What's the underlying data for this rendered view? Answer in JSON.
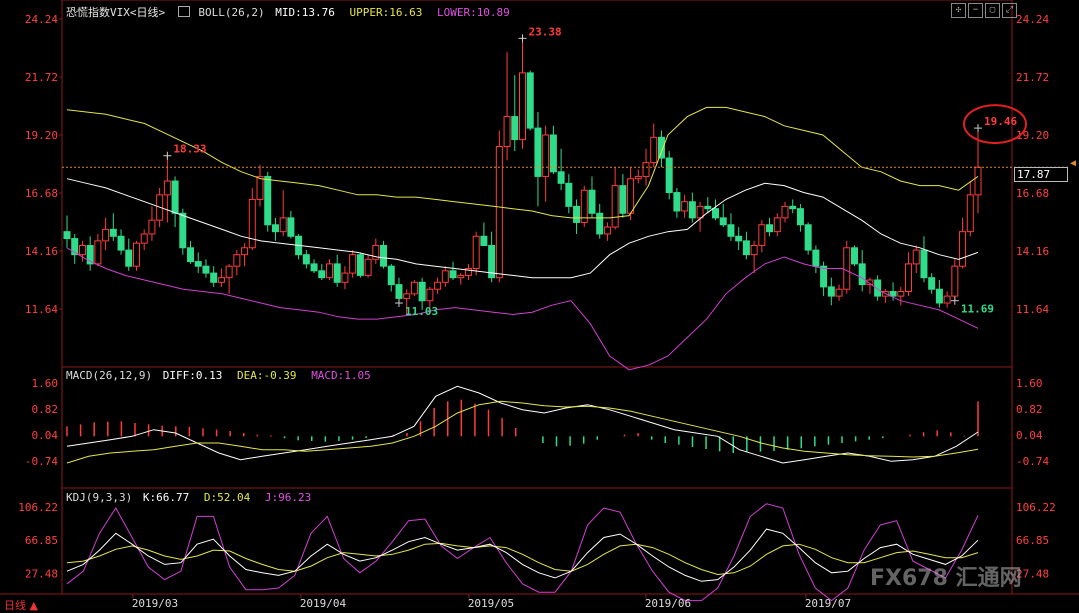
{
  "header": {
    "title": "恐慌指数VIX<日线>",
    "boll_label": "BOLL(26,2)",
    "boll_mid": "MID:13.76",
    "boll_upper": "UPPER:16.63",
    "boll_lower": "LOWER:10.89"
  },
  "macd_header": {
    "name": "MACD(26,12,9)",
    "diff": "DIFF:0.13",
    "dea": "DEA:-0.39",
    "macd": "MACD:1.05"
  },
  "kdj_header": {
    "name": "KDJ(9,3,3)",
    "k": "K:66.77",
    "d": "D:52.04",
    "j": "J:96.23"
  },
  "period_label": "日线",
  "current_price_tag": "17.87",
  "watermark": "FX678 汇通网",
  "colors": {
    "up": "#ff3b3b",
    "down": "#2fdc8a",
    "upper": "#e6e64a",
    "mid": "#ffffff",
    "lower": "#d040d0",
    "axis_text": "#ff4040",
    "kdj_k": "#ffffff",
    "kdj_d": "#e6e64a",
    "kdj_j": "#d040d0"
  },
  "chart_data": [
    {
      "type": "candlestick",
      "title": "恐慌指数VIX<日线>",
      "y_ticks": [
        "24.24",
        "21.72",
        "19.20",
        "16.68",
        "14.16",
        "11.64"
      ],
      "ylim": [
        11.64,
        24.24
      ],
      "x_ticks": [
        "2019/03",
        "2019/04",
        "2019/05",
        "2019/06",
        "2019/07"
      ],
      "annotations": [
        "18.33",
        "23.38",
        "11.03",
        "19.46",
        "11.69"
      ],
      "series_ohlc": [
        [
          15.0,
          15.7,
          14.3,
          14.7
        ],
        [
          14.7,
          14.9,
          13.6,
          14.0
        ],
        [
          14.0,
          14.6,
          13.7,
          14.4
        ],
        [
          14.4,
          14.8,
          13.3,
          13.6
        ],
        [
          13.6,
          14.9,
          13.5,
          14.6
        ],
        [
          14.6,
          15.6,
          14.2,
          15.1
        ],
        [
          15.1,
          15.8,
          14.6,
          14.8
        ],
        [
          14.8,
          15.1,
          14.0,
          14.2
        ],
        [
          14.2,
          14.7,
          13.3,
          13.5
        ],
        [
          13.5,
          14.6,
          13.3,
          14.5
        ],
        [
          14.5,
          15.1,
          14.2,
          14.9
        ],
        [
          14.9,
          16.1,
          14.6,
          15.5
        ],
        [
          15.5,
          16.9,
          15.2,
          16.6
        ],
        [
          16.6,
          18.3,
          15.4,
          17.2
        ],
        [
          17.2,
          17.4,
          15.2,
          15.8
        ],
        [
          15.8,
          16.0,
          14.0,
          14.3
        ],
        [
          14.3,
          14.6,
          13.6,
          13.7
        ],
        [
          13.7,
          14.1,
          13.2,
          13.5
        ],
        [
          13.5,
          13.8,
          13.0,
          13.2
        ],
        [
          13.2,
          13.5,
          12.6,
          12.8
        ],
        [
          12.8,
          13.4,
          12.6,
          13.0
        ],
        [
          13.0,
          13.6,
          12.3,
          13.5
        ],
        [
          13.5,
          14.2,
          13.1,
          14.0
        ],
        [
          14.0,
          14.5,
          13.5,
          14.3
        ],
        [
          14.3,
          16.9,
          14.2,
          16.4
        ],
        [
          16.4,
          17.9,
          16.1,
          17.4
        ],
        [
          17.4,
          17.6,
          15.0,
          15.3
        ],
        [
          15.3,
          15.6,
          14.6,
          15.0
        ],
        [
          15.0,
          16.8,
          14.8,
          15.6
        ],
        [
          15.6,
          15.9,
          14.7,
          14.8
        ],
        [
          14.8,
          14.9,
          13.8,
          14.0
        ],
        [
          14.0,
          14.2,
          13.4,
          13.6
        ],
        [
          13.6,
          13.8,
          13.2,
          13.3
        ],
        [
          13.3,
          13.6,
          12.9,
          13.0
        ],
        [
          13.0,
          13.8,
          12.9,
          13.6
        ],
        [
          13.6,
          14.0,
          12.6,
          12.8
        ],
        [
          12.8,
          13.5,
          12.5,
          13.2
        ],
        [
          13.2,
          14.2,
          13.0,
          14.0
        ],
        [
          14.0,
          14.1,
          13.0,
          13.1
        ],
        [
          13.1,
          14.0,
          13.0,
          13.8
        ],
        [
          13.8,
          14.7,
          13.6,
          14.4
        ],
        [
          14.4,
          14.6,
          13.4,
          13.5
        ],
        [
          13.5,
          13.6,
          12.4,
          12.7
        ],
        [
          12.7,
          13.0,
          11.9,
          12.1
        ],
        [
          12.1,
          12.5,
          11.4,
          12.3
        ],
        [
          12.3,
          12.9,
          12.2,
          12.8
        ],
        [
          12.8,
          13.0,
          11.6,
          12.0
        ],
        [
          12.0,
          12.6,
          11.7,
          12.5
        ],
        [
          12.5,
          13.0,
          12.3,
          12.8
        ],
        [
          12.8,
          13.5,
          12.6,
          13.3
        ],
        [
          13.3,
          13.7,
          12.9,
          13.0
        ],
        [
          13.0,
          13.2,
          12.7,
          13.1
        ],
        [
          13.1,
          13.6,
          12.9,
          13.4
        ],
        [
          13.4,
          15.0,
          13.1,
          14.8
        ],
        [
          14.8,
          15.4,
          14.5,
          14.4
        ],
        [
          14.4,
          15.0,
          12.8,
          13.0
        ],
        [
          13.0,
          19.4,
          12.8,
          18.7
        ],
        [
          18.7,
          22.8,
          18.1,
          20.0
        ],
        [
          20.0,
          21.8,
          18.5,
          19.0
        ],
        [
          19.0,
          23.4,
          18.6,
          21.9
        ],
        [
          21.9,
          22.0,
          19.4,
          19.5
        ],
        [
          19.5,
          20.2,
          16.1,
          17.4
        ],
        [
          17.4,
          19.6,
          16.3,
          19.2
        ],
        [
          19.2,
          19.6,
          17.5,
          17.6
        ],
        [
          17.6,
          18.6,
          16.8,
          17.1
        ],
        [
          17.1,
          17.5,
          15.8,
          16.1
        ],
        [
          16.1,
          16.4,
          14.9,
          15.4
        ],
        [
          15.4,
          17.0,
          15.2,
          16.8
        ],
        [
          16.8,
          17.4,
          15.6,
          15.8
        ],
        [
          15.8,
          16.2,
          14.7,
          14.9
        ],
        [
          14.9,
          15.4,
          14.6,
          15.2
        ],
        [
          15.2,
          17.8,
          15.1,
          17.0
        ],
        [
          17.0,
          17.5,
          15.6,
          15.8
        ],
        [
          15.8,
          17.8,
          15.5,
          17.3
        ],
        [
          17.3,
          17.7,
          17.1,
          17.4
        ],
        [
          17.4,
          18.6,
          17.0,
          18.0
        ],
        [
          18.0,
          19.7,
          17.8,
          19.1
        ],
        [
          19.1,
          19.4,
          17.8,
          18.2
        ],
        [
          18.2,
          18.5,
          16.4,
          16.7
        ],
        [
          16.7,
          16.9,
          15.6,
          15.9
        ],
        [
          15.9,
          16.6,
          15.6,
          16.3
        ],
        [
          16.3,
          16.7,
          15.4,
          15.6
        ],
        [
          15.6,
          16.3,
          15.0,
          16.1
        ],
        [
          16.1,
          16.5,
          15.8,
          16.0
        ],
        [
          16.0,
          16.4,
          15.5,
          15.6
        ],
        [
          15.6,
          16.2,
          15.2,
          15.3
        ],
        [
          15.3,
          15.8,
          14.6,
          14.8
        ],
        [
          14.8,
          15.2,
          14.2,
          14.6
        ],
        [
          14.6,
          15.0,
          13.8,
          14.0
        ],
        [
          14.0,
          14.6,
          13.2,
          14.4
        ],
        [
          14.4,
          15.5,
          14.1,
          15.3
        ],
        [
          15.3,
          15.6,
          14.8,
          15.0
        ],
        [
          15.0,
          15.8,
          14.8,
          15.6
        ],
        [
          15.6,
          16.3,
          15.4,
          16.1
        ],
        [
          16.1,
          16.4,
          15.8,
          16.0
        ],
        [
          16.0,
          16.2,
          15.0,
          15.3
        ],
        [
          15.3,
          15.4,
          14.0,
          14.2
        ],
        [
          14.2,
          14.4,
          13.2,
          13.5
        ],
        [
          13.5,
          13.7,
          12.2,
          12.6
        ],
        [
          12.6,
          13.0,
          11.8,
          12.2
        ],
        [
          12.2,
          12.7,
          12.0,
          12.5
        ],
        [
          12.5,
          14.6,
          12.3,
          14.3
        ],
        [
          14.3,
          14.4,
          13.5,
          13.6
        ],
        [
          13.6,
          14.2,
          12.4,
          12.7
        ],
        [
          12.7,
          13.0,
          12.3,
          12.9
        ],
        [
          12.9,
          13.1,
          12.0,
          12.2
        ],
        [
          12.2,
          12.5,
          11.9,
          12.4
        ],
        [
          12.4,
          12.8,
          12.0,
          12.2
        ],
        [
          12.2,
          12.6,
          11.8,
          12.4
        ],
        [
          12.4,
          14.1,
          12.2,
          13.6
        ],
        [
          13.6,
          14.4,
          13.2,
          14.2
        ],
        [
          14.2,
          14.8,
          12.8,
          13.0
        ],
        [
          13.0,
          13.2,
          12.3,
          12.5
        ],
        [
          12.5,
          12.9,
          11.7,
          11.9
        ],
        [
          11.9,
          12.4,
          11.7,
          12.2
        ],
        [
          12.2,
          13.8,
          12.0,
          13.5
        ],
        [
          13.5,
          15.6,
          13.4,
          15.0
        ],
        [
          15.0,
          17.2,
          14.8,
          16.6
        ],
        [
          16.6,
          19.5,
          15.8,
          17.8
        ]
      ],
      "upper_band": [
        20.3,
        20.2,
        20.1,
        19.9,
        19.7,
        19.3,
        18.9,
        18.5,
        18.0,
        17.6,
        17.3,
        17.2,
        17.1,
        17.0,
        16.8,
        16.6,
        16.6,
        16.5,
        16.5,
        16.4,
        16.3,
        16.2,
        16.1,
        16.0,
        15.9,
        15.7,
        15.6,
        15.6,
        15.6,
        15.7,
        17.0,
        19.2,
        20.0,
        20.4,
        20.4,
        20.2,
        20.0,
        19.6,
        19.4,
        19.2,
        18.5,
        17.8,
        17.6,
        17.2,
        17.0,
        17.0,
        16.8,
        17.4
      ],
      "mid_band": [
        17.3,
        17.1,
        16.9,
        16.6,
        16.3,
        16.0,
        15.7,
        15.4,
        15.1,
        14.8,
        14.6,
        14.5,
        14.4,
        14.3,
        14.2,
        14.1,
        13.9,
        13.8,
        13.6,
        13.5,
        13.4,
        13.3,
        13.2,
        13.1,
        13.0,
        13.0,
        13.0,
        13.2,
        14.0,
        14.5,
        14.8,
        15.0,
        15.1,
        15.8,
        16.4,
        16.8,
        17.1,
        17.0,
        16.7,
        16.5,
        16.0,
        15.5,
        14.9,
        14.5,
        14.3,
        14.0,
        13.8,
        14.1
      ],
      "lower_band": [
        14.3,
        13.8,
        13.4,
        13.1,
        12.9,
        12.7,
        12.5,
        12.4,
        12.3,
        12.1,
        11.9,
        11.7,
        11.6,
        11.5,
        11.3,
        11.2,
        11.2,
        11.3,
        11.4,
        11.6,
        11.7,
        11.6,
        11.5,
        11.4,
        11.5,
        11.8,
        12.0,
        11.0,
        9.6,
        9.0,
        9.2,
        9.6,
        10.4,
        11.2,
        12.3,
        13.0,
        13.6,
        13.9,
        13.6,
        13.4,
        13.4,
        13.0,
        12.4,
        12.0,
        11.8,
        11.6,
        11.2,
        10.8
      ]
    },
    {
      "type": "bar",
      "title": "MACD(26,12,9)",
      "y_ticks": [
        "1.60",
        "0.82",
        "0.04",
        "-0.74"
      ],
      "ylim": [
        -0.74,
        1.6
      ],
      "macd_hist": [
        0.3,
        0.36,
        0.42,
        0.44,
        0.45,
        0.4,
        0.36,
        0.32,
        0.3,
        0.28,
        0.24,
        0.2,
        0.16,
        0.1,
        0.05,
        0.03,
        -0.06,
        -0.12,
        -0.14,
        -0.16,
        -0.14,
        -0.1,
        -0.05,
        0.0,
        0.05,
        0.1,
        0.45,
        0.85,
        1.05,
        1.1,
        0.98,
        0.8,
        0.55,
        0.25,
        0.0,
        -0.2,
        -0.3,
        -0.28,
        -0.22,
        -0.1,
        0.0,
        0.05,
        0.1,
        -0.1,
        -0.2,
        -0.25,
        -0.32,
        -0.38,
        -0.45,
        -0.5,
        -0.48,
        -0.46,
        -0.44,
        -0.4,
        -0.36,
        -0.3,
        -0.25,
        -0.2,
        -0.15,
        -0.1,
        -0.05,
        0.0,
        0.05,
        0.12,
        0.18,
        0.12,
        0.02,
        1.05
      ],
      "diff": [
        -0.3,
        -0.2,
        -0.1,
        0.0,
        0.2,
        0.1,
        -0.2,
        -0.5,
        -0.7,
        -0.6,
        -0.5,
        -0.4,
        -0.3,
        -0.2,
        -0.1,
        0.0,
        0.3,
        1.2,
        1.5,
        1.3,
        1.0,
        0.8,
        0.7,
        0.85,
        0.95,
        0.8,
        0.6,
        0.4,
        0.2,
        0.1,
        0.0,
        -0.4,
        -0.6,
        -0.8,
        -0.7,
        -0.6,
        -0.5,
        -0.6,
        -0.75,
        -0.7,
        -0.6,
        -0.3,
        0.13
      ],
      "dea": [
        -0.8,
        -0.6,
        -0.5,
        -0.45,
        -0.4,
        -0.3,
        -0.2,
        -0.2,
        -0.3,
        -0.4,
        -0.4,
        -0.45,
        -0.4,
        -0.35,
        -0.3,
        -0.2,
        0.0,
        0.3,
        0.7,
        0.95,
        1.05,
        1.0,
        0.92,
        0.88,
        0.9,
        0.85,
        0.75,
        0.6,
        0.45,
        0.3,
        0.15,
        0.0,
        -0.2,
        -0.35,
        -0.45,
        -0.5,
        -0.55,
        -0.58,
        -0.6,
        -0.62,
        -0.6,
        -0.5,
        -0.39
      ]
    },
    {
      "type": "line",
      "title": "KDJ(9,3,3)",
      "y_ticks": [
        "106.22",
        "66.85",
        "27.48"
      ],
      "ylim": [
        10,
        106.22
      ],
      "k": [
        30,
        38,
        55,
        75,
        62,
        48,
        38,
        40,
        62,
        68,
        48,
        32,
        28,
        25,
        30,
        48,
        62,
        50,
        42,
        46,
        55,
        65,
        70,
        62,
        55,
        58,
        62,
        52,
        38,
        28,
        22,
        30,
        52,
        70,
        74,
        62,
        48,
        35,
        25,
        18,
        20,
        35,
        55,
        80,
        75,
        58,
        40,
        28,
        30,
        45,
        58,
        62,
        50,
        44,
        38,
        48,
        66.77
      ],
      "d": [
        40,
        42,
        48,
        56,
        60,
        55,
        48,
        44,
        48,
        55,
        54,
        45,
        38,
        32,
        30,
        36,
        46,
        52,
        50,
        48,
        50,
        55,
        62,
        63,
        60,
        58,
        60,
        58,
        50,
        40,
        32,
        30,
        38,
        50,
        60,
        62,
        58,
        50,
        40,
        32,
        26,
        28,
        36,
        50,
        60,
        62,
        56,
        46,
        40,
        40,
        46,
        52,
        54,
        50,
        46,
        46,
        52.04
      ],
      "j": [
        15,
        30,
        75,
        105,
        70,
        35,
        20,
        30,
        95,
        95,
        35,
        8,
        8,
        10,
        25,
        75,
        95,
        45,
        28,
        42,
        65,
        90,
        92,
        60,
        45,
        58,
        70,
        40,
        15,
        5,
        5,
        30,
        85,
        105,
        100,
        62,
        30,
        5,
        -5,
        -5,
        10,
        48,
        95,
        110,
        105,
        50,
        10,
        -5,
        10,
        55,
        85,
        90,
        42,
        32,
        22,
        55,
        96.23
      ],
      "x_ticks": [
        "2019/03",
        "2019/04",
        "2019/05",
        "2019/06",
        "2019/07"
      ]
    }
  ]
}
